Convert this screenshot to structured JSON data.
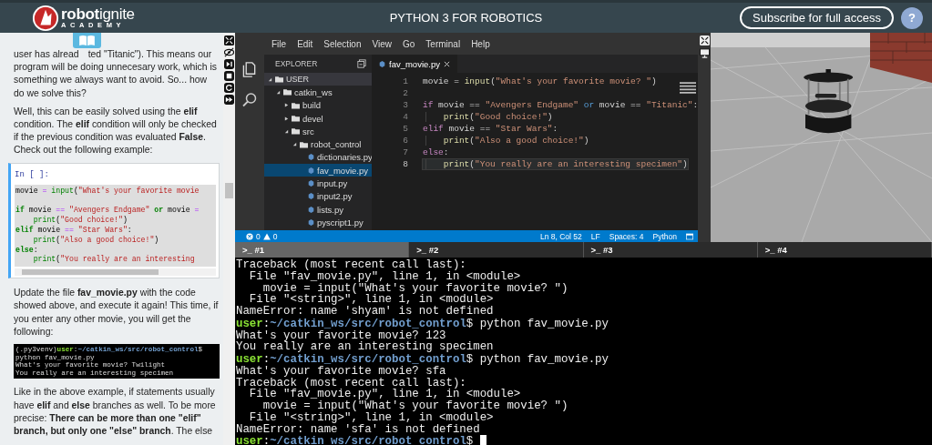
{
  "header": {
    "logo": "**robot**ignite",
    "logo_subtitle": "ACADEMY",
    "title": "PYTHON 3 FOR ROBOTICS",
    "subscribe_button": "Subscribe for full access",
    "help_button": "?"
  },
  "notebook": {
    "blocks": [
      {
        "kind": "paragraph",
        "lead": "user has alread",
        "text": "ted \"Titanic\"). This means our program will be doing unnecesary work, which is something we always want to avoid. So... how do we solve this?"
      },
      {
        "kind": "paragraph",
        "text": "Well, this can be easily solved using the **elif** condition. The **elif** condition will only be checked if the previous condition was evaluated **False**. Check out the following example:"
      },
      {
        "kind": "code_cell",
        "prompt": "In [ ]:",
        "lines": [
          {
            "kind": "code",
            "indented": false,
            "tokens": [
              {
                "kind": "plain",
                "text": "movie "
              },
              {
                "kind": "operator",
                "text": "= "
              },
              {
                "kind": "function",
                "text": "input"
              },
              {
                "kind": "plain",
                "text": "("
              },
              {
                "kind": "string",
                "text": "\"What's your favorite movie"
              }
            ]
          },
          {
            "kind": "blank"
          },
          {
            "kind": "code",
            "indented": false,
            "tokens": [
              {
                "kind": "keyword",
                "text": "if"
              },
              {
                "kind": "plain",
                "text": " movie "
              },
              {
                "kind": "operator",
                "text": "== "
              },
              {
                "kind": "string",
                "text": "\"Avengers Endgame\" "
              },
              {
                "kind": "operator_word",
                "text": "or"
              },
              {
                "kind": "plain",
                "text": " movie "
              },
              {
                "kind": "operator",
                "text": "="
              }
            ]
          },
          {
            "kind": "code",
            "indented": true,
            "tokens": [
              {
                "kind": "function",
                "text": "print"
              },
              {
                "kind": "plain",
                "text": "("
              },
              {
                "kind": "string",
                "text": "\"Good choice!\""
              },
              {
                "kind": "plain",
                "text": ")"
              }
            ]
          },
          {
            "kind": "code",
            "indented": false,
            "tokens": [
              {
                "kind": "keyword",
                "text": "elif"
              },
              {
                "kind": "plain",
                "text": " movie "
              },
              {
                "kind": "operator",
                "text": "== "
              },
              {
                "kind": "string",
                "text": "\"Star Wars\""
              },
              {
                "kind": "plain",
                "text": ":"
              }
            ]
          },
          {
            "kind": "code",
            "indented": true,
            "tokens": [
              {
                "kind": "function",
                "text": "print"
              },
              {
                "kind": "plain",
                "text": "("
              },
              {
                "kind": "string",
                "text": "\"Also a good choice!\""
              },
              {
                "kind": "plain",
                "text": ")"
              }
            ]
          },
          {
            "kind": "code",
            "indented": false,
            "tokens": [
              {
                "kind": "keyword",
                "text": "else"
              },
              {
                "kind": "plain",
                "text": ":"
              }
            ]
          },
          {
            "kind": "code",
            "indented": true,
            "tokens": [
              {
                "kind": "function",
                "text": "print"
              },
              {
                "kind": "plain",
                "text": "("
              },
              {
                "kind": "string",
                "text": "\"You really are an interesting"
              }
            ]
          }
        ]
      },
      {
        "kind": "paragraph",
        "text": "Update the file **fav_movie.py** with the code showed above, and execute it again! This time, if you enter any other movie, you will get the following:"
      },
      {
        "kind": "terminal_image",
        "lines": [
          {
            "kind": "prompt",
            "env": "(.py3venv)",
            "user": "user",
            "colon": ":",
            "path": "~/catkin_ws/src/robot_control",
            "symbol": "$",
            "command": "python fav_movie.py"
          },
          {
            "kind": "output",
            "text": "What's your favorite movie? Twilight"
          },
          {
            "kind": "output",
            "text": "You really are an interesting specimen"
          }
        ]
      },
      {
        "kind": "paragraph",
        "text": "Like in the above example, if statements usually have **elif** and **else** branches as well. To be more precise: **There can be more than one \"elif\" branch, but only one \"else\" branch**. The else"
      }
    ]
  },
  "ide": {
    "menu": [
      "File",
      "Edit",
      "Selection",
      "View",
      "Go",
      "Terminal",
      "Help"
    ],
    "explorer": {
      "title": "EXPLORER",
      "tree": [
        {
          "label": "USER",
          "kind": "folder",
          "expanded": true,
          "selected": false,
          "children": [
            {
              "label": "catkin_ws",
              "kind": "folder",
              "expanded": true,
              "selected": false,
              "children": [
                {
                  "label": "build",
                  "kind": "folder",
                  "expanded": false,
                  "selected": false
                },
                {
                  "label": "devel",
                  "kind": "folder",
                  "expanded": false,
                  "selected": false
                },
                {
                  "label": "src",
                  "kind": "folder",
                  "expanded": true,
                  "selected": false,
                  "children": [
                    {
                      "label": "robot_control",
                      "kind": "folder",
                      "expanded": true,
                      "selected": false,
                      "children": [
                        {
                          "label": "dictionaries.py",
                          "kind": "file",
                          "selected": false
                        },
                        {
                          "label": "fav_movie.py",
                          "kind": "file",
                          "selected": true
                        },
                        {
                          "label": "input.py",
                          "kind": "file",
                          "selected": false
                        },
                        {
                          "label": "input2.py",
                          "kind": "file",
                          "selected": false
                        },
                        {
                          "label": "lists.py",
                          "kind": "file",
                          "selected": false
                        },
                        {
                          "label": "pyscript1.py",
                          "kind": "file",
                          "selected": false
                        }
                      ]
                    }
                  ]
                }
              ]
            }
          ]
        }
      ]
    },
    "tabs": [
      {
        "label": "fav_movie.py",
        "selected": true
      }
    ],
    "lines": [
      {
        "number": "1",
        "current": false,
        "indented": false,
        "tokens": [
          {
            "kind": "plain",
            "text": "movie "
          },
          {
            "kind": "operator",
            "text": "= "
          },
          {
            "kind": "function",
            "text": "input"
          },
          {
            "kind": "plain",
            "text": "("
          },
          {
            "kind": "string",
            "text": "\"What's your favorite movie? \""
          },
          {
            "kind": "plain",
            "text": ")"
          }
        ]
      },
      {
        "number": "2",
        "current": false
      },
      {
        "number": "3",
        "current": false,
        "indented": false,
        "tokens": [
          {
            "kind": "keyword",
            "text": "if"
          },
          {
            "kind": "plain",
            "text": " movie "
          },
          {
            "kind": "operator",
            "text": "== "
          },
          {
            "kind": "string",
            "text": "\"Avengers Endgame\" "
          },
          {
            "kind": "operator_word",
            "text": "or"
          },
          {
            "kind": "plain",
            "text": " movie "
          },
          {
            "kind": "operator",
            "text": "== "
          },
          {
            "kind": "string",
            "text": "\"Titanic\""
          },
          {
            "kind": "plain",
            "text": ":"
          }
        ]
      },
      {
        "number": "4",
        "current": false,
        "indented": true,
        "tokens": [
          {
            "kind": "function",
            "text": "print"
          },
          {
            "kind": "plain",
            "text": "("
          },
          {
            "kind": "string",
            "text": "\"Good choice!\""
          },
          {
            "kind": "plain",
            "text": ")"
          }
        ]
      },
      {
        "number": "5",
        "current": false,
        "indented": false,
        "tokens": [
          {
            "kind": "keyword",
            "text": "elif"
          },
          {
            "kind": "plain",
            "text": " movie "
          },
          {
            "kind": "operator",
            "text": "== "
          },
          {
            "kind": "string",
            "text": "\"Star Wars\""
          },
          {
            "kind": "plain",
            "text": ":"
          }
        ]
      },
      {
        "number": "6",
        "current": false,
        "indented": true,
        "tokens": [
          {
            "kind": "function",
            "text": "print"
          },
          {
            "kind": "plain",
            "text": "("
          },
          {
            "kind": "string",
            "text": "\"Also a good choice!\""
          },
          {
            "kind": "plain",
            "text": ")"
          }
        ]
      },
      {
        "number": "7",
        "current": false,
        "indented": false,
        "tokens": [
          {
            "kind": "keyword",
            "text": "else"
          },
          {
            "kind": "plain",
            "text": ":"
          }
        ]
      },
      {
        "number": "8",
        "current": true,
        "indented": true,
        "tokens": [
          {
            "kind": "function",
            "text": "print"
          },
          {
            "kind": "plain",
            "text": "("
          },
          {
            "kind": "string",
            "text": "\"You really are an interesting specimen\""
          },
          {
            "kind": "plain",
            "text": ")"
          }
        ]
      }
    ],
    "status_bar": {
      "errors": "0",
      "warnings": "0",
      "items": [
        "Ln 8, Col 52",
        "LF",
        "Spaces: 4",
        "Python"
      ]
    }
  },
  "terminal": {
    "tabs": [
      {
        "label": ">_ #1",
        "selected": true
      },
      {
        "label": ">_ #2",
        "selected": false
      },
      {
        "label": ">_ #3",
        "selected": false
      },
      {
        "label": ">_ #4",
        "selected": false
      }
    ],
    "lines": [
      {
        "kind": "output",
        "text": "Traceback (most recent call last):"
      },
      {
        "kind": "output",
        "text": "  File \"fav_movie.py\", line 1, in <module>"
      },
      {
        "kind": "output",
        "text": "    movie = input(\"What's your favorite movie? \")"
      },
      {
        "kind": "output",
        "text": "  File \"<string>\", line 1, in <module>"
      },
      {
        "kind": "output",
        "text": "NameError: name 'shyam' is not defined"
      },
      {
        "kind": "prompt",
        "user": "user",
        "colon": ":",
        "path": "~/catkin_ws/src/robot_control",
        "symbol": "$",
        "command": "python fav_movie.py",
        "cursor": false
      },
      {
        "kind": "output",
        "text": "What's your favorite movie? 123"
      },
      {
        "kind": "output",
        "text": "You really are an interesting specimen"
      },
      {
        "kind": "prompt",
        "user": "user",
        "colon": ":",
        "path": "~/catkin_ws/src/robot_control",
        "symbol": "$",
        "command": "python fav_movie.py",
        "cursor": false
      },
      {
        "kind": "output",
        "text": "What's your favorite movie? sfa"
      },
      {
        "kind": "output",
        "text": "Traceback (most recent call last):"
      },
      {
        "kind": "output",
        "text": "  File \"fav_movie.py\", line 1, in <module>"
      },
      {
        "kind": "output",
        "text": "    movie = input(\"What's your favorite movie? \")"
      },
      {
        "kind": "output",
        "text": "  File \"<string>\", line 1, in <module>"
      },
      {
        "kind": "output",
        "text": "NameError: name 'sfa' is not defined"
      },
      {
        "kind": "prompt",
        "user": "user",
        "colon": ":",
        "path": "~/catkin_ws/src/robot_control",
        "symbol": "$",
        "cursor": true
      }
    ]
  }
}
